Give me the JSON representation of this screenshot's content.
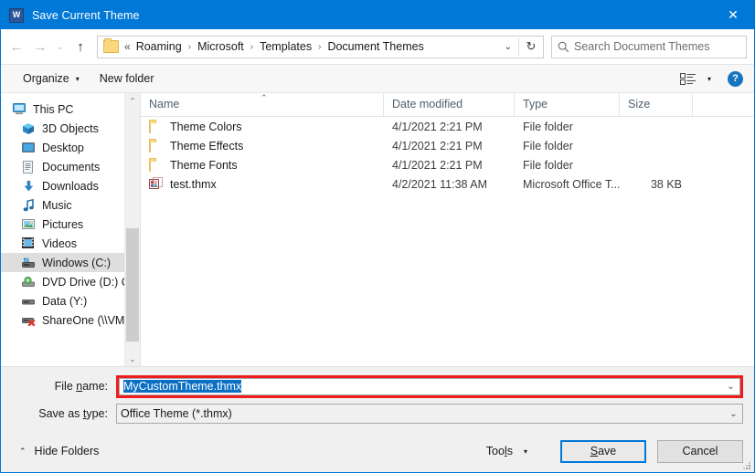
{
  "window": {
    "title": "Save Current Theme",
    "app_icon": "word-icon",
    "app_icon_letter": "W",
    "close_label": "✕",
    "accent_color": "#0078d7",
    "highlight_color": "#ee1c1c"
  },
  "navbar": {
    "back_icon": "←",
    "forward_icon": "→",
    "recent_icon": "⌄",
    "up_icon": "↑",
    "overflow": "«",
    "breadcrumbs": [
      "Roaming",
      "Microsoft",
      "Templates",
      "Document Themes"
    ],
    "separator": "›",
    "dropdown_icon": "⌄",
    "refresh_icon": "↻",
    "search_icon": "⚲",
    "search_placeholder": "Search Document Themes"
  },
  "commandbar": {
    "organize_label": "Organize",
    "organize_caret": "▾",
    "new_folder_label": "New folder",
    "view_caret": "▾",
    "help_label": "?"
  },
  "sidebar": {
    "items": [
      {
        "label": "This PC",
        "icon": "monitor-icon",
        "level": 0,
        "selected": false
      },
      {
        "label": "3D Objects",
        "icon": "cube-icon",
        "level": 1,
        "selected": false
      },
      {
        "label": "Desktop",
        "icon": "desktop-icon",
        "level": 1,
        "selected": false
      },
      {
        "label": "Documents",
        "icon": "documents-icon",
        "level": 1,
        "selected": false
      },
      {
        "label": "Downloads",
        "icon": "downloads-icon",
        "level": 1,
        "selected": false
      },
      {
        "label": "Music",
        "icon": "music-icon",
        "level": 1,
        "selected": false
      },
      {
        "label": "Pictures",
        "icon": "pictures-icon",
        "level": 1,
        "selected": false
      },
      {
        "label": "Videos",
        "icon": "videos-icon",
        "level": 1,
        "selected": false
      },
      {
        "label": "Windows (C:)",
        "icon": "hard-drive-icon",
        "level": 1,
        "selected": true
      },
      {
        "label": "DVD Drive (D:) C",
        "icon": "dvd-drive-icon",
        "level": 1,
        "selected": false
      },
      {
        "label": "Data (Y:)",
        "icon": "network-drive-icon",
        "level": 1,
        "selected": false
      },
      {
        "label": "ShareOne (\\\\VM",
        "icon": "disconnected-drive-icon",
        "level": 1,
        "selected": false
      }
    ],
    "scroll_up_icon": "⌃",
    "scroll_down_icon": "⌄"
  },
  "filelist": {
    "sort_caret": "⌃",
    "columns": [
      {
        "key": "name",
        "label": "Name"
      },
      {
        "key": "date",
        "label": "Date modified"
      },
      {
        "key": "type",
        "label": "Type"
      },
      {
        "key": "size",
        "label": "Size"
      }
    ],
    "rows": [
      {
        "icon": "folder-icon",
        "name": "Theme Colors",
        "date": "4/1/2021 2:21 PM",
        "type": "File folder",
        "size": ""
      },
      {
        "icon": "folder-icon",
        "name": "Theme Effects",
        "date": "4/1/2021 2:21 PM",
        "type": "File folder",
        "size": ""
      },
      {
        "icon": "folder-icon",
        "name": "Theme Fonts",
        "date": "4/1/2021 2:21 PM",
        "type": "File folder",
        "size": ""
      },
      {
        "icon": "office-theme-file-icon",
        "name": "test.thmx",
        "date": "4/2/2021 11:38 AM",
        "type": "Microsoft Office T...",
        "size": "38 KB"
      }
    ]
  },
  "form": {
    "file_name_label_pre": "File ",
    "file_name_label_accel": "n",
    "file_name_label_post": "ame:",
    "file_name_value": "MyCustomTheme.thmx",
    "file_name_selected": true,
    "save_as_type_label_pre": "Save as ",
    "save_as_type_label_accel": "t",
    "save_as_type_label_post": "ype:",
    "save_as_type_value": "Office Theme (*.thmx)",
    "dropdown_icon": "⌄"
  },
  "footer": {
    "hide_folders_caret": "⌃",
    "hide_folders_label": "Hide Folders",
    "tools_label_pre": "Too",
    "tools_label_accel": "l",
    "tools_label_post": "s",
    "tools_caret": "▾",
    "save_label_pre": "",
    "save_label_accel": "S",
    "save_label_post": "ave",
    "cancel_label": "Cancel"
  }
}
